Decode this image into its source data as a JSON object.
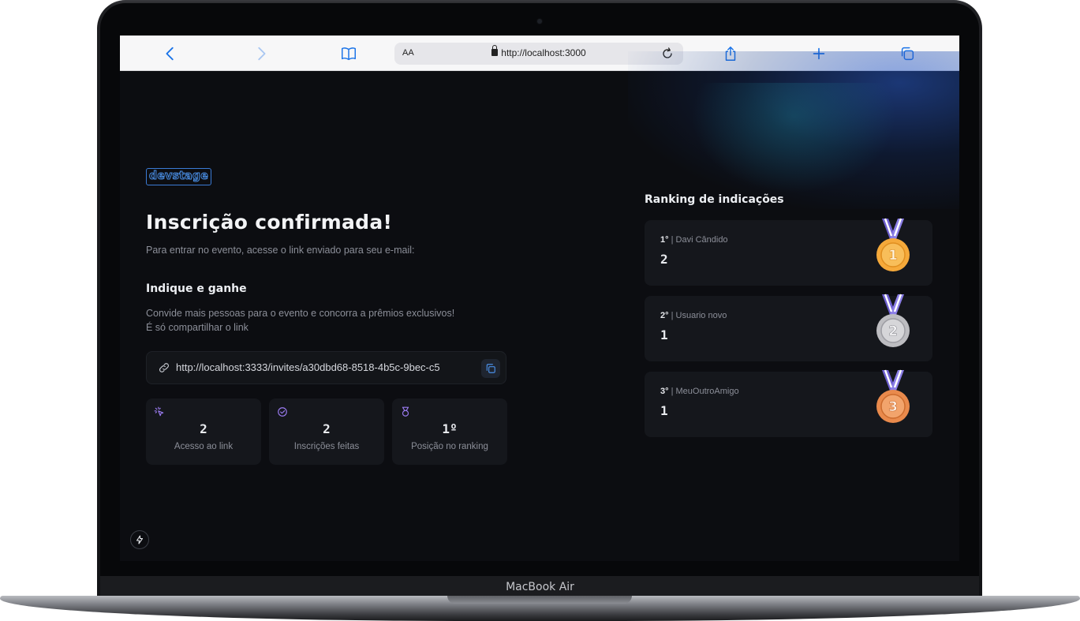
{
  "device": {
    "label": "MacBook Air"
  },
  "browser": {
    "aa_label": "AA",
    "url": "http://localhost:3000"
  },
  "page": {
    "logo": "devstage",
    "title": "Inscrição confirmada!",
    "subtitle": "Para entrar no evento, acesse o link enviado para seu e-mail:",
    "invite_section": {
      "title": "Indique e ganhe",
      "line1": "Convide mais pessoas para o evento e concorra a prêmios exclusivos!",
      "line2": "É só compartilhar o link",
      "link": "http://localhost:3333/invites/a30dbd68-8518-4b5c-9bec-c5"
    },
    "stats": [
      {
        "icon": "cursor-click-icon",
        "value": "2",
        "label": "Acesso ao link"
      },
      {
        "icon": "badge-check-icon",
        "value": "2",
        "label": "Inscrições feitas"
      },
      {
        "icon": "medal-icon",
        "value": "1º",
        "label": "Posição no ranking"
      }
    ],
    "ranking": {
      "title": "Ranking de indicações",
      "entries": [
        {
          "position": "1°",
          "name": "Davi Cândido",
          "score": "2",
          "medal": "gold",
          "medal_number": "1"
        },
        {
          "position": "2°",
          "name": "Usuario novo",
          "score": "1",
          "medal": "silver",
          "medal_number": "2"
        },
        {
          "position": "3°",
          "name": "MeuOutroAmigo",
          "score": "1",
          "medal": "bronze",
          "medal_number": "3"
        }
      ]
    }
  },
  "colors": {
    "background": "#0c0d11",
    "card": "#15171c",
    "accent_blue": "#3b7bd6",
    "accent_purple": "#9a7bf0",
    "gold": "#f5a93a",
    "silver": "#c9c9cc",
    "bronze": "#e98a4c"
  }
}
